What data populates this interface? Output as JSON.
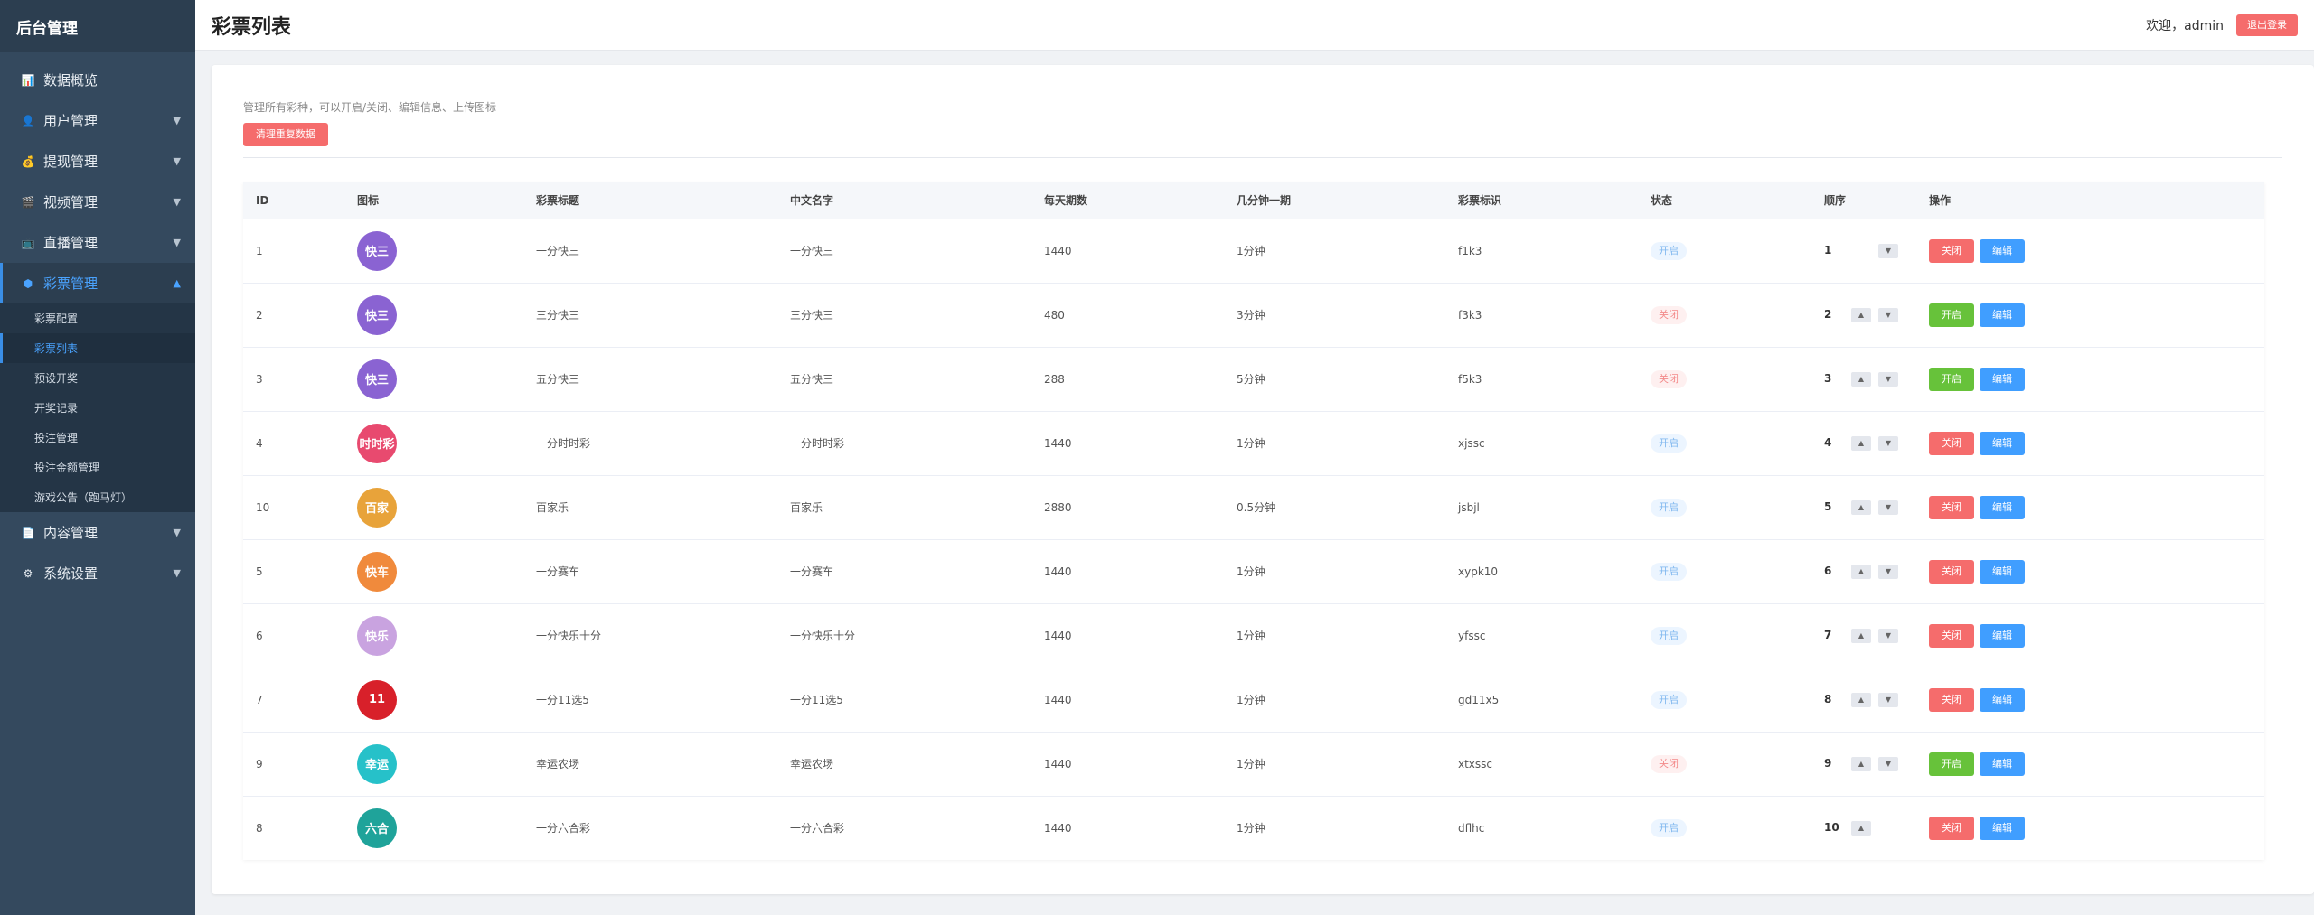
{
  "sidebar": {
    "brand": "后台管理",
    "items": [
      {
        "label": "数据概览",
        "icon": "📊",
        "has_arrow": false
      },
      {
        "label": "用户管理",
        "icon": "👤",
        "has_arrow": true
      },
      {
        "label": "提现管理",
        "icon": "💰",
        "has_arrow": true
      },
      {
        "label": "视频管理",
        "icon": "🎬",
        "has_arrow": true
      },
      {
        "label": "直播管理",
        "icon": "📺",
        "has_arrow": true
      },
      {
        "label": "彩票管理",
        "icon": "⬢",
        "has_arrow": true,
        "active": true
      }
    ],
    "sub_items": [
      {
        "label": "彩票配置"
      },
      {
        "label": "彩票列表",
        "active": true
      },
      {
        "label": "预设开奖"
      },
      {
        "label": "开奖记录"
      },
      {
        "label": "投注管理"
      },
      {
        "label": "投注金额管理"
      },
      {
        "label": "游戏公告（跑马灯）"
      }
    ],
    "bottom_items": [
      {
        "label": "内容管理",
        "icon": "📄",
        "has_arrow": true
      },
      {
        "label": "系统设置",
        "icon": "⚙",
        "has_arrow": true
      }
    ]
  },
  "header": {
    "title": "彩票列表",
    "welcome": "欢迎，admin",
    "logout_label": "退出登录"
  },
  "panel": {
    "description": "管理所有彩种，可以开启/关闭、编辑信息、上传图标",
    "clean_button": "清理重复数据"
  },
  "table": {
    "columns": [
      "ID",
      "图标",
      "彩票标题",
      "中文名字",
      "每天期数",
      "几分钟一期",
      "彩票标识",
      "状态",
      "顺序",
      "操作"
    ],
    "rows": [
      {
        "id": "1",
        "logo_text": "快三",
        "logo_color": "#8a63d2",
        "title": "一分快三",
        "cn_name": "一分快三",
        "per_day": "1440",
        "interval": "1分钟",
        "code": "f1k3",
        "status": "开启",
        "order": "1",
        "action": "关闭",
        "edit": "编辑"
      },
      {
        "id": "2",
        "logo_text": "快三",
        "logo_color": "#8a63d2",
        "title": "三分快三",
        "cn_name": "三分快三",
        "per_day": "480",
        "interval": "3分钟",
        "code": "f3k3",
        "status": "关闭",
        "order": "2",
        "action": "开启",
        "edit": "编辑"
      },
      {
        "id": "3",
        "logo_text": "快三",
        "logo_color": "#8a63d2",
        "title": "五分快三",
        "cn_name": "五分快三",
        "per_day": "288",
        "interval": "5分钟",
        "code": "f5k3",
        "status": "关闭",
        "order": "3",
        "action": "开启",
        "edit": "编辑"
      },
      {
        "id": "4",
        "logo_text": "时时彩",
        "logo_color": "#e84a6f",
        "title": "一分时时彩",
        "cn_name": "一分时时彩",
        "per_day": "1440",
        "interval": "1分钟",
        "code": "xjssc",
        "status": "开启",
        "order": "4",
        "action": "关闭",
        "edit": "编辑"
      },
      {
        "id": "10",
        "logo_text": "百家",
        "logo_color": "#e8a33a",
        "title": "百家乐",
        "cn_name": "百家乐",
        "per_day": "2880",
        "interval": "0.5分钟",
        "code": "jsbjl",
        "status": "开启",
        "order": "5",
        "action": "关闭",
        "edit": "编辑"
      },
      {
        "id": "5",
        "logo_text": "快车",
        "logo_color": "#f08a3c",
        "title": "一分赛车",
        "cn_name": "一分赛车",
        "per_day": "1440",
        "interval": "1分钟",
        "code": "xypk10",
        "status": "开启",
        "order": "6",
        "action": "关闭",
        "edit": "编辑"
      },
      {
        "id": "6",
        "logo_text": "快乐",
        "logo_color": "#c9a3e0",
        "title": "一分快乐十分",
        "cn_name": "一分快乐十分",
        "per_day": "1440",
        "interval": "1分钟",
        "code": "yfssc",
        "status": "开启",
        "order": "7",
        "action": "关闭",
        "edit": "编辑"
      },
      {
        "id": "7",
        "logo_text": "11",
        "logo_color": "#d8202a",
        "title": "一分11选5",
        "cn_name": "一分11选5",
        "per_day": "1440",
        "interval": "1分钟",
        "code": "gd11x5",
        "status": "开启",
        "order": "8",
        "action": "关闭",
        "edit": "编辑"
      },
      {
        "id": "9",
        "logo_text": "幸运",
        "logo_color": "#26c1c9",
        "title": "幸运农场",
        "cn_name": "幸运农场",
        "per_day": "1440",
        "interval": "1分钟",
        "code": "xtxssc",
        "status": "关闭",
        "order": "9",
        "action": "开启",
        "edit": "编辑"
      },
      {
        "id": "8",
        "logo_text": "六合",
        "logo_color": "#1fa39a",
        "title": "一分六合彩",
        "cn_name": "一分六合彩",
        "per_day": "1440",
        "interval": "1分钟",
        "code": "dflhc",
        "status": "开启",
        "order": "10",
        "action": "关闭",
        "edit": "编辑"
      }
    ]
  },
  "colors": {
    "sidebar_bg": "#34495e",
    "accent": "#409eff",
    "danger": "#f56c6c",
    "success": "#67c23a"
  }
}
